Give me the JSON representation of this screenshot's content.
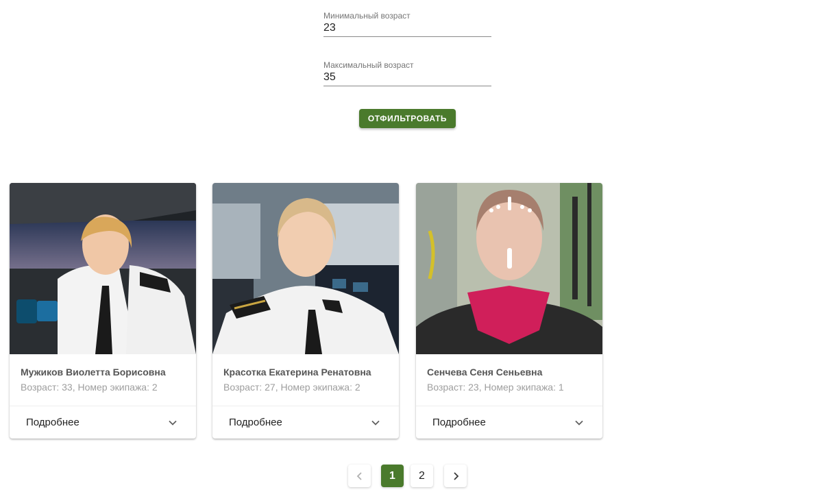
{
  "filter": {
    "min_age_label": "Минимальный возраст",
    "min_age_value": "23",
    "max_age_label": "Максимальный возраст",
    "max_age_value": "35",
    "submit_label": "Отфильтровать"
  },
  "cards": [
    {
      "name": "Мужиков Виолетта Борисовна",
      "info": "Возраст: 33, Номер экипажа: 2",
      "expand_label": "Подробнее",
      "expand_icon": "chevron-down-icon"
    },
    {
      "name": "Красотка Екатерина Ренатовна",
      "info": "Возраст: 27, Номер экипажа: 2",
      "expand_label": "Подробнее",
      "expand_icon": "chevron-down-icon"
    },
    {
      "name": "Сенчева Сеня Сеньевна",
      "info": "Возраст: 23, Номер экипажа: 1",
      "expand_label": "Подробнее",
      "expand_icon": "chevron-down-icon"
    }
  ],
  "pagination": {
    "prev_icon": "chevron-left-icon",
    "pages": [
      "1",
      "2"
    ],
    "current_page": "1",
    "next_icon": "chevron-right-icon"
  },
  "colors": {
    "accent": "#4a7a2c",
    "muted_text": "#9e9e9e"
  }
}
